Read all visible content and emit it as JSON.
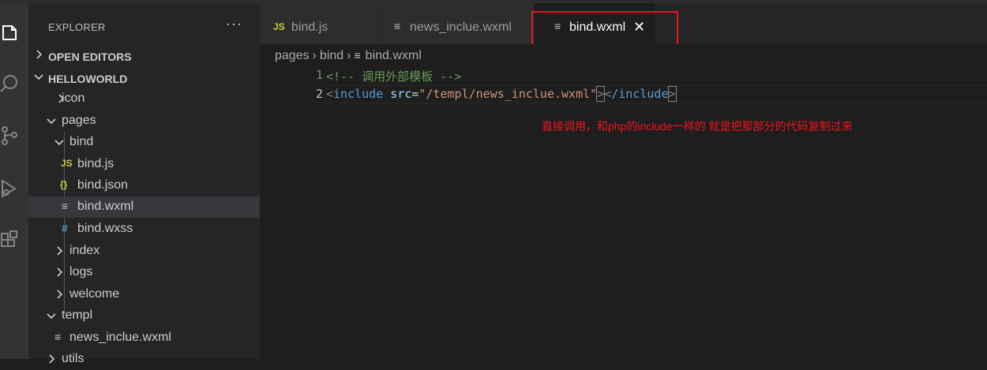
{
  "explorer": {
    "title": "EXPLORER",
    "more": "···",
    "open_editors": "OPEN EDITORS",
    "project": "HELLOWORLD",
    "tree": [
      {
        "label": "icon",
        "type": "folder",
        "expanded": false
      },
      {
        "label": "pages",
        "type": "folder",
        "expanded": true
      },
      {
        "label": "bind",
        "type": "folder",
        "expanded": true
      },
      {
        "label": "bind.js",
        "type": "js",
        "icon": "JS"
      },
      {
        "label": "bind.json",
        "type": "json",
        "icon": "{}"
      },
      {
        "label": "bind.wxml",
        "type": "wxml",
        "icon": "≡",
        "selected": true
      },
      {
        "label": "bind.wxss",
        "type": "wxss",
        "icon": "#"
      },
      {
        "label": "index",
        "type": "folder",
        "expanded": false
      },
      {
        "label": "logs",
        "type": "folder",
        "expanded": false
      },
      {
        "label": "welcome",
        "type": "folder",
        "expanded": false
      },
      {
        "label": "templ",
        "type": "folder",
        "expanded": true
      },
      {
        "label": "news_inclue.wxml",
        "type": "wxml",
        "icon": "≡"
      },
      {
        "label": "utils",
        "type": "folder",
        "expanded": false
      }
    ]
  },
  "tabs": [
    {
      "label": "bind.js",
      "icon": "JS",
      "active": false
    },
    {
      "label": "news_inclue.wxml",
      "icon": "≡",
      "active": false
    },
    {
      "label": "bind.wxml",
      "icon": "≡",
      "active": true,
      "close": "✕"
    }
  ],
  "breadcrumb": [
    "pages",
    "bind",
    "bind.wxml"
  ],
  "breadcrumb_sep": "›",
  "editor": {
    "line_numbers": [
      "1",
      "2"
    ],
    "line1": {
      "comment": "<!-- 调用外部模板 -->"
    },
    "line2": {
      "open_bracket": "<",
      "tag": "include",
      "space": " ",
      "attr": "src",
      "eq": "=",
      "value": "\"/templ/news_inclue.wxml\"",
      "close_bracket": ">",
      "end_open": "<",
      "end_tag": "/include",
      "end_close": ">"
    }
  },
  "annotation": "直接调用，和php的include一样的 就是把那部分的代码复制过来",
  "colors": {
    "annotation": "#f0141e",
    "highlight_box": "#e2191c",
    "js_icon": "#cbcb41",
    "json_icon": "#cbcb41",
    "wxss_icon": "#519aba"
  }
}
